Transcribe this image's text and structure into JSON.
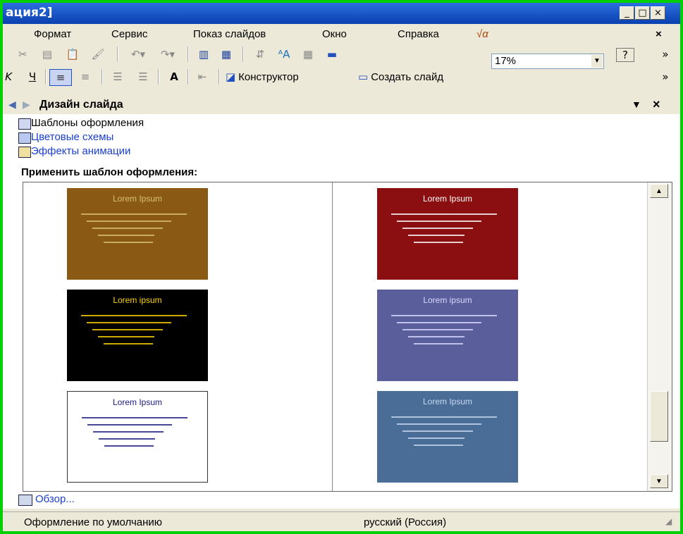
{
  "window": {
    "title": "ация2]",
    "min": "_",
    "max": "□",
    "close": "×"
  },
  "menu": {
    "items": [
      "Формат",
      "Сервис",
      "Показ слайдов",
      "Окно",
      "Справка"
    ],
    "help_icon": "√α",
    "close": "×"
  },
  "toolbar1": {
    "zoom": "17%",
    "help": "?",
    "more": "»"
  },
  "toolbar2": {
    "designer": "Конструктор",
    "new_slide": "Создать слайд",
    "more": "»"
  },
  "pane": {
    "title": "Дизайн слайда",
    "links": [
      "Шаблоны оформления",
      "Цветовые схемы",
      "Эффекты анимации"
    ],
    "apply_label": "Применить шаблон оформления:",
    "browse": "Обзор..."
  },
  "thumbs": [
    {
      "title": "Lorem Ipsum",
      "bg": "#8a5a14",
      "fg": "#d9c070"
    },
    {
      "title": "Lorem Ipsum",
      "bg": "#8b0f10",
      "fg": "#ffffff"
    },
    {
      "title": "Lorem ipsum",
      "bg": "#000000",
      "fg": "#ffd400"
    },
    {
      "title": "Lorem ipsum",
      "bg": "#5a5e9a",
      "fg": "#d8d8ff"
    },
    {
      "title": "Lorem Ipsum",
      "bg": "#ffffff",
      "fg": "#1a1a80"
    },
    {
      "title": "Lorem Ipsum",
      "bg": "#4a6d98",
      "fg": "#c8d8f0"
    }
  ],
  "status": {
    "left": "Оформление по умолчанию",
    "center": "русский (Россия)"
  }
}
